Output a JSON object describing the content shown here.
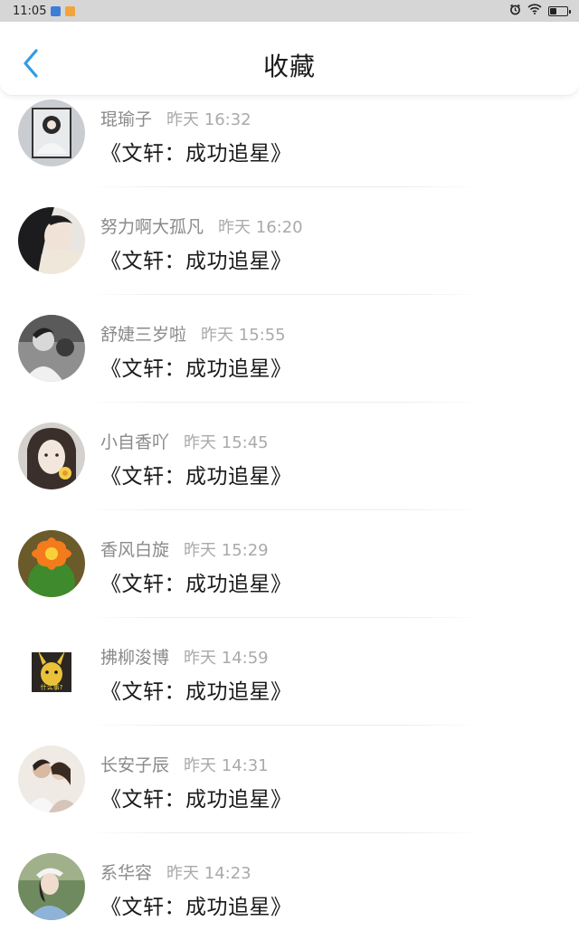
{
  "status_bar": {
    "time": "11:05"
  },
  "header": {
    "title": "收藏",
    "accent_color": "#2f9de4"
  },
  "items": [
    {
      "user": "琨瑜子",
      "time": "昨天 16:32",
      "content": "《文轩：成功追星》",
      "avatar_icon": "avatar-gray-jacket"
    },
    {
      "user": "努力啊大孤凡",
      "time": "昨天 16:20",
      "content": "《文轩：成功追星》",
      "avatar_icon": "avatar-dark-hair-scarf"
    },
    {
      "user": "舒婕三岁啦",
      "time": "昨天 15:55",
      "content": "《文轩：成功追星》",
      "avatar_icon": "avatar-bw-portrait"
    },
    {
      "user": "小自香吖",
      "time": "昨天 15:45",
      "content": "《文轩：成功追星》",
      "avatar_icon": "avatar-girl-flower"
    },
    {
      "user": "香风白旋",
      "time": "昨天 15:29",
      "content": "《文轩：成功追星》",
      "avatar_icon": "avatar-cactus-flower"
    },
    {
      "user": "拂柳浚博",
      "time": "昨天 14:59",
      "content": "《文轩：成功追星》",
      "avatar_icon": "avatar-pikachu",
      "avatar_caption": "什么事?"
    },
    {
      "user": "长安子辰",
      "time": "昨天 14:31",
      "content": "《文轩：成功追星》",
      "avatar_icon": "avatar-couple"
    },
    {
      "user": "系华容",
      "time": "昨天 14:23",
      "content": "《文轩：成功追星》",
      "avatar_icon": "avatar-girl-cap"
    }
  ]
}
